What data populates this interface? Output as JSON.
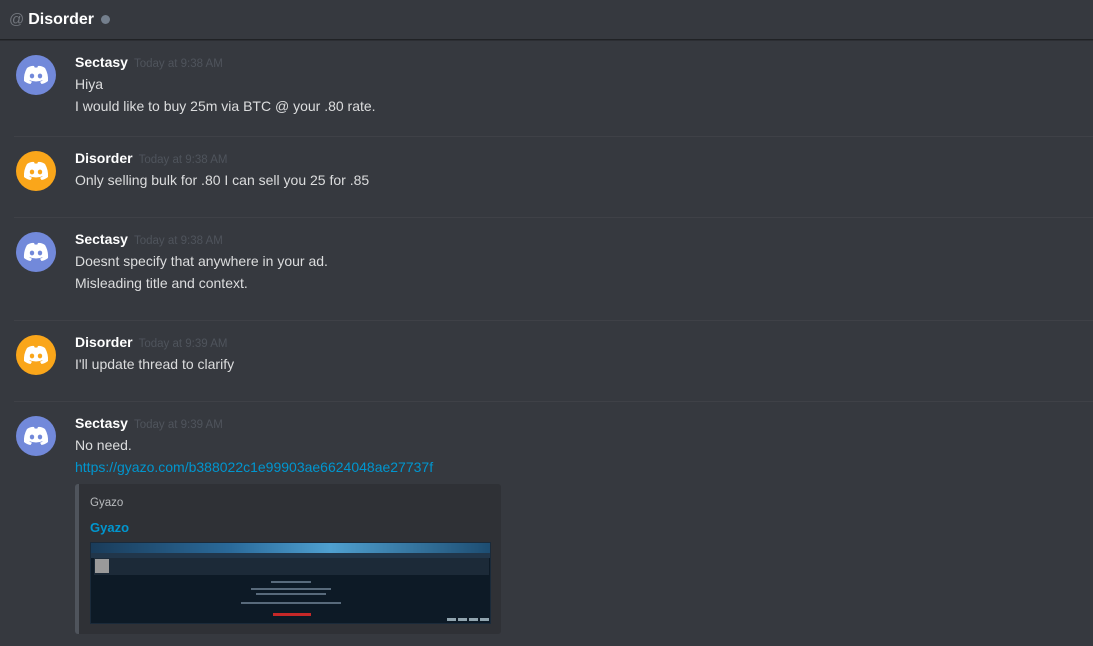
{
  "header": {
    "at_symbol": "@",
    "channel_name": "Disorder"
  },
  "colors": {
    "sectasy_avatar": "#7289da",
    "disorder_avatar": "#faa61a",
    "link": "#0096cf"
  },
  "messages": [
    {
      "username": "Sectasy",
      "timestamp": "Today at 9:38 AM",
      "avatar_icon": "discord-logo-icon",
      "lines": [
        "Hiya",
        "I would like to buy 25m via BTC @ your .80 rate."
      ]
    },
    {
      "username": "Disorder",
      "timestamp": "Today at 9:38 AM",
      "avatar_icon": "discord-logo-icon",
      "lines": [
        "Only selling bulk for .80 I can sell you 25 for .85"
      ]
    },
    {
      "username": "Sectasy",
      "timestamp": "Today at 9:38 AM",
      "avatar_icon": "discord-logo-icon",
      "lines": [
        "Doesnt specify that anywhere in your ad.",
        "Misleading title and context."
      ]
    },
    {
      "username": "Disorder",
      "timestamp": "Today at 9:39 AM",
      "avatar_icon": "discord-logo-icon",
      "lines": [
        "I'll update thread to clarify"
      ]
    },
    {
      "username": "Sectasy",
      "timestamp": "Today at 9:39 AM",
      "avatar_icon": "discord-logo-icon",
      "lines": [
        "No need."
      ],
      "link": "https://gyazo.com/b388022c1e99903ae6624048ae27737f",
      "embed": {
        "provider": "Gyazo",
        "title": "Gyazo"
      }
    }
  ]
}
